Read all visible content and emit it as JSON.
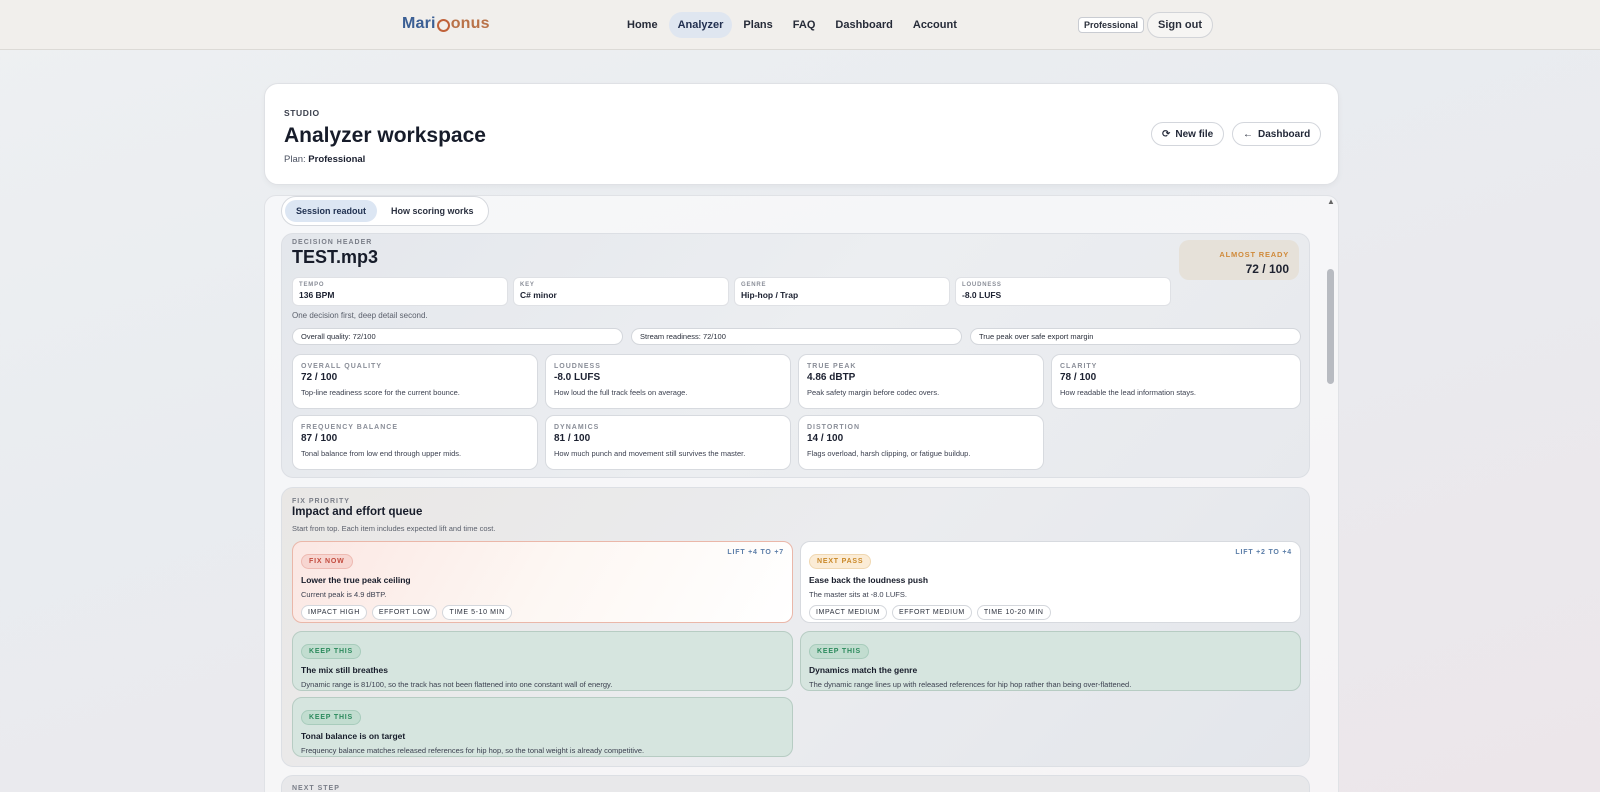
{
  "nav": {
    "logo_part1": "Mari",
    "logo_part2": "onus",
    "links": [
      "Home",
      "Analyzer",
      "Plans",
      "FAQ",
      "Dashboard",
      "Account"
    ],
    "active_link": "Analyzer",
    "plan_badge": "Professional",
    "signout_label": "Sign out"
  },
  "header": {
    "eyebrow": "STUDIO",
    "title": "Analyzer workspace",
    "plan_label": "Plan:",
    "plan_value": "Professional",
    "new_file_label": "New file",
    "new_file_icon": "refresh-icon",
    "dashboard_label": "Dashboard",
    "dashboard_icon": "arrow-left-icon"
  },
  "tabs": [
    "Session readout",
    "How scoring works"
  ],
  "decision": {
    "eyebrow": "DECISION HEADER",
    "file_name": "TEST.mp3",
    "status_label": "ALMOST READY",
    "status_score": "72 / 100",
    "meta": [
      {
        "key": "TEMPO",
        "value": "136 BPM"
      },
      {
        "key": "KEY",
        "value": "C# minor"
      },
      {
        "key": "GENRE",
        "value": "Hip-hop / Trap"
      },
      {
        "key": "LOUDNESS",
        "value": "-8.0 LUFS"
      }
    ],
    "tagline": "One decision first, deep detail second.",
    "pills": [
      "Overall quality: 72/100",
      "Stream readiness: 72/100",
      "True peak over safe export margin"
    ],
    "metrics": [
      {
        "key": "OVERALL QUALITY",
        "value": "72 / 100",
        "desc": "Top-line readiness score for the current bounce."
      },
      {
        "key": "LOUDNESS",
        "value": "-8.0 LUFS",
        "desc": "How loud the full track feels on average."
      },
      {
        "key": "TRUE PEAK",
        "value": "4.86 dBTP",
        "desc": "Peak safety margin before codec overs."
      },
      {
        "key": "CLARITY",
        "value": "78 / 100",
        "desc": "How readable the lead information stays."
      },
      {
        "key": "FREQUENCY BALANCE",
        "value": "87 / 100",
        "desc": "Tonal balance from low end through upper mids."
      },
      {
        "key": "DYNAMICS",
        "value": "81 / 100",
        "desc": "How much punch and movement still survives the master."
      },
      {
        "key": "DISTORTION",
        "value": "14 / 100",
        "desc": "Flags overload, harsh clipping, or fatigue buildup."
      }
    ]
  },
  "fix": {
    "eyebrow": "FIX PRIORITY",
    "title": "Impact and effort queue",
    "subtitle": "Start from top. Each item includes expected lift and time cost.",
    "cards": [
      {
        "tag": "FIX NOW",
        "lift": "LIFT +4 TO +7",
        "title": "Lower the true peak ceiling",
        "desc": "Current peak is 4.9 dBTP.",
        "chips": [
          "IMPACT HIGH",
          "EFFORT LOW",
          "TIME 5-10 MIN"
        ]
      },
      {
        "tag": "NEXT PASS",
        "lift": "LIFT +2 TO +4",
        "title": "Ease back the loudness push",
        "desc": "The master sits at -8.0 LUFS.",
        "chips": [
          "IMPACT MEDIUM",
          "EFFORT MEDIUM",
          "TIME 10-20 MIN"
        ]
      },
      {
        "tag": "KEEP THIS",
        "title": "The mix still breathes",
        "desc": "Dynamic range is 81/100, so the track has not been flattened into one constant wall of energy."
      },
      {
        "tag": "KEEP THIS",
        "title": "Dynamics match the genre",
        "desc": "The dynamic range lines up with released references for hip hop rather than being over-flattened."
      },
      {
        "tag": "KEEP THIS",
        "title": "Tonal balance is on target",
        "desc": "Frequency balance matches released references for hip hop, so the tonal weight is already competitive."
      }
    ]
  },
  "next_step": {
    "eyebrow": "NEXT STEP"
  }
}
